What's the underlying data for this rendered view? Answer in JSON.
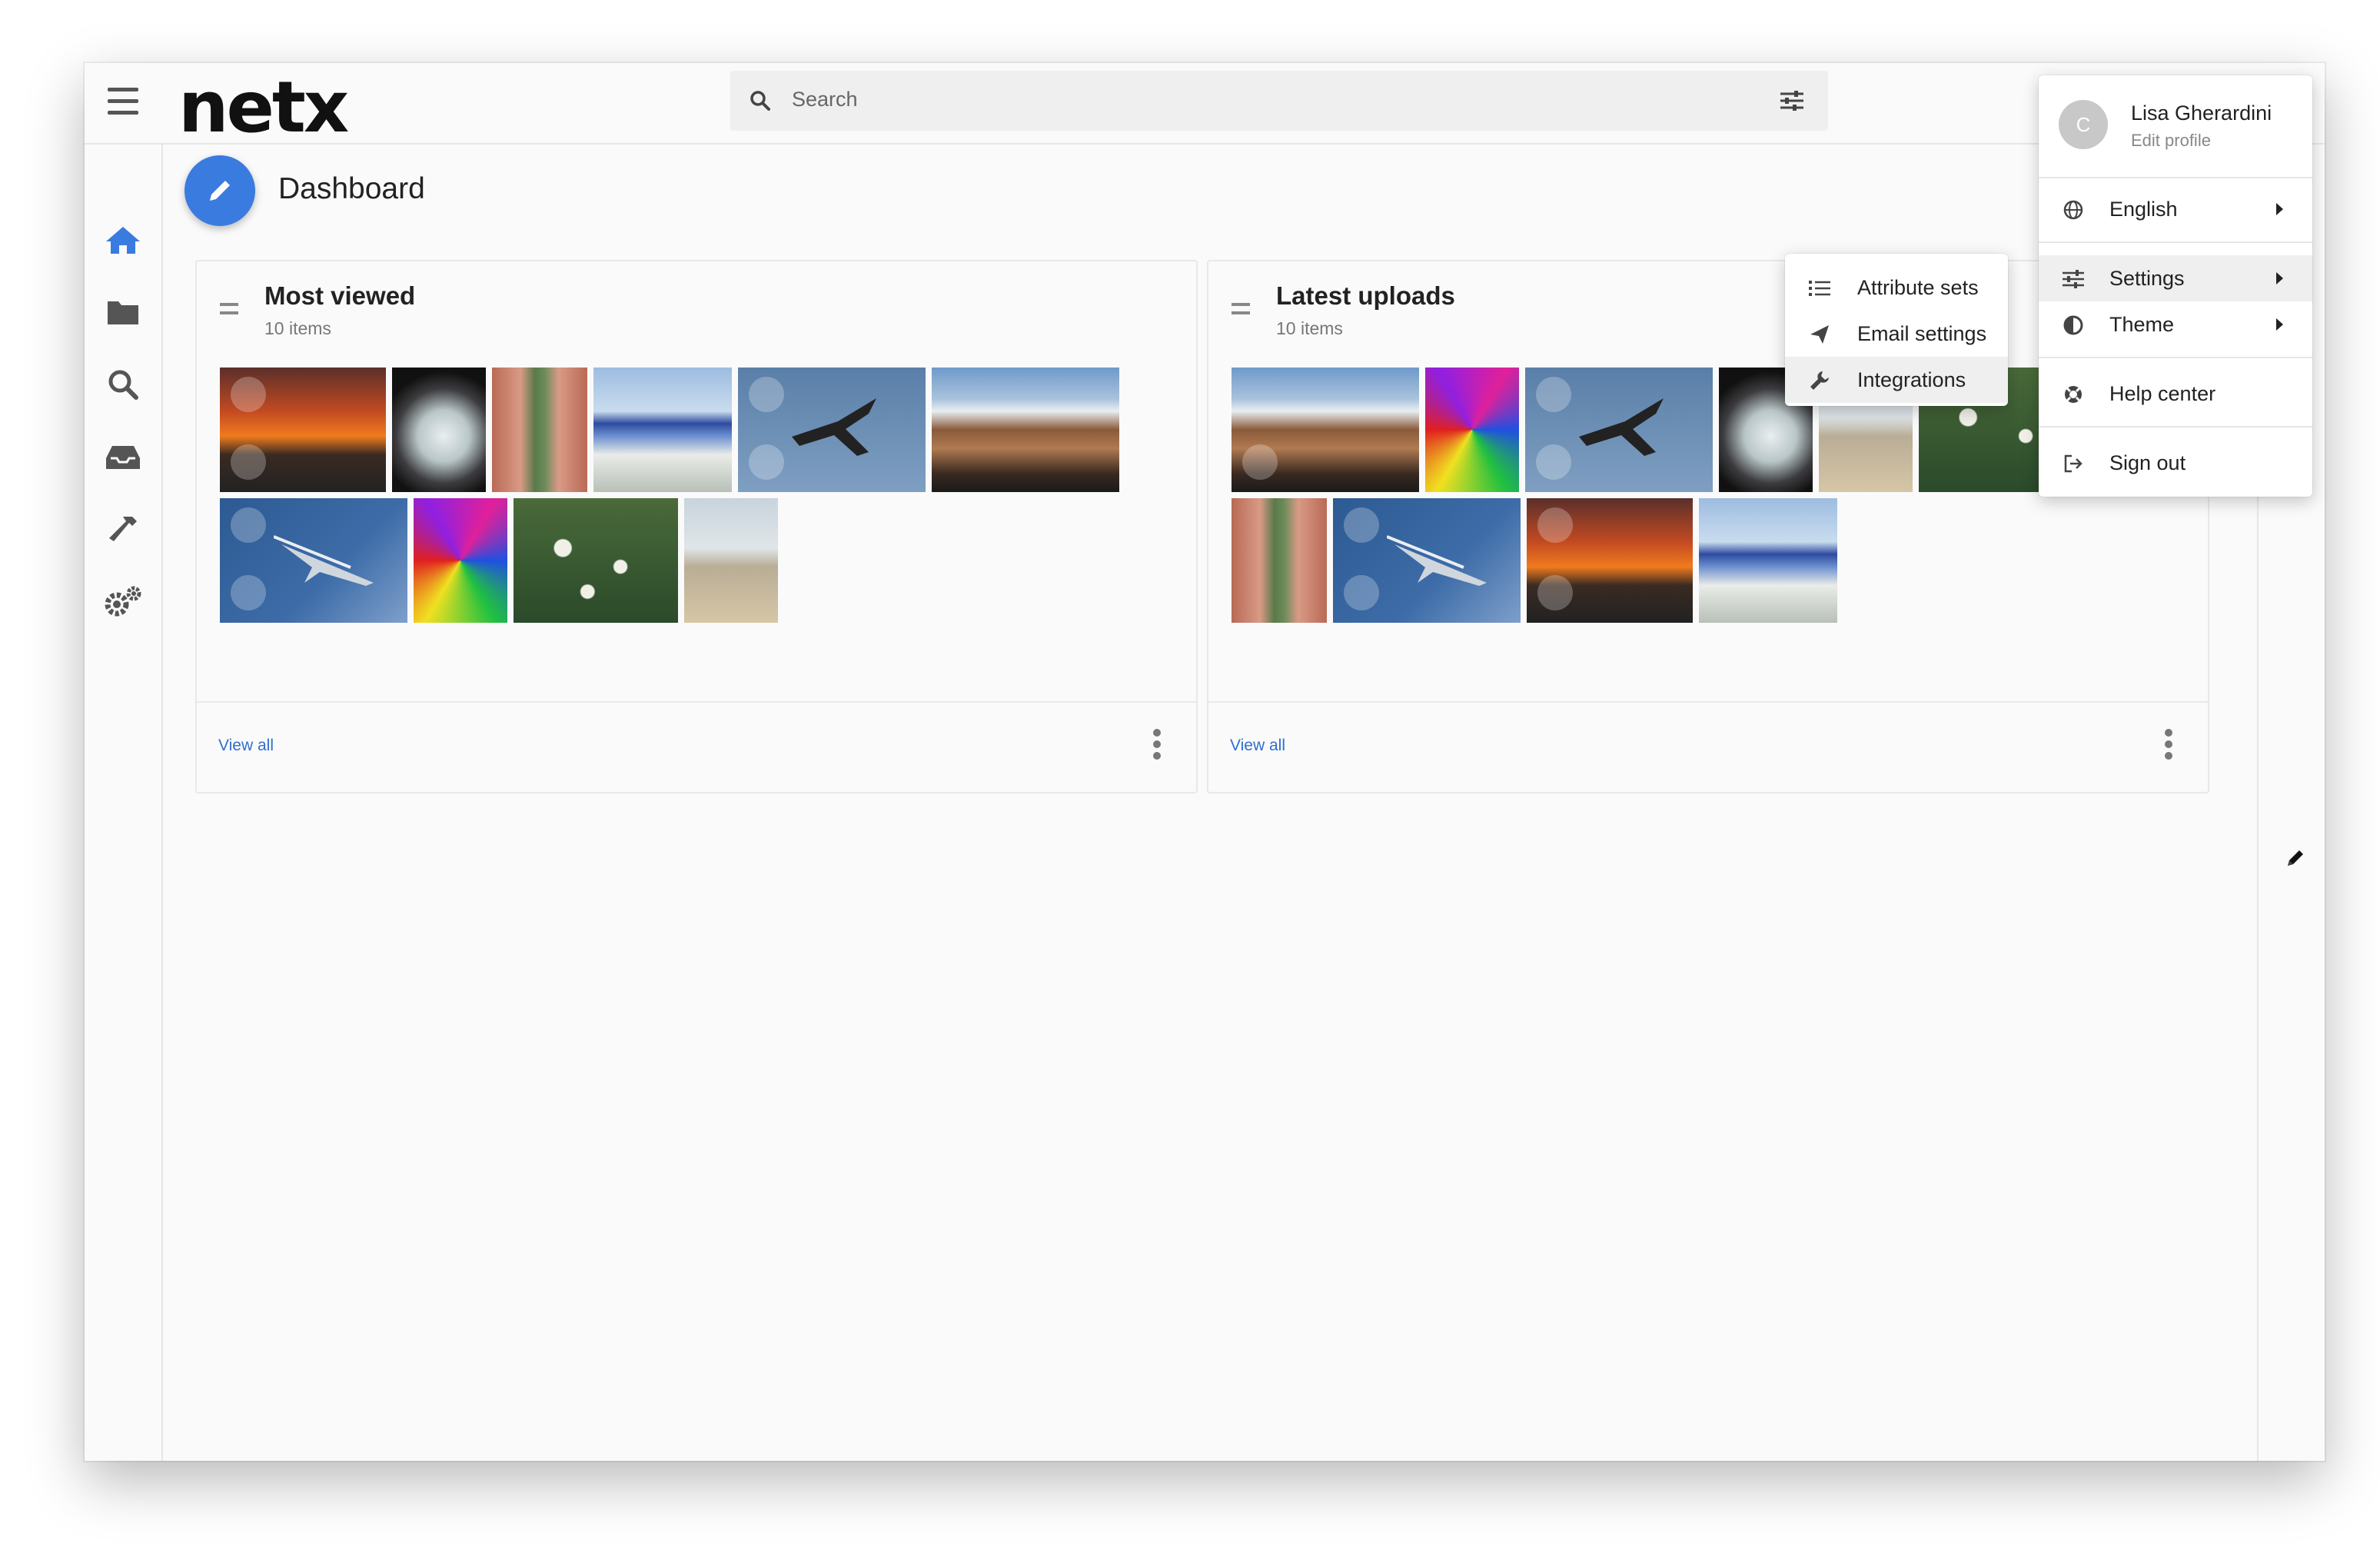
{
  "app": {
    "logo": "netx"
  },
  "search": {
    "placeholder": "Search"
  },
  "page": {
    "title": "Dashboard"
  },
  "nav": [
    "home-icon",
    "folder-icon",
    "search-icon",
    "inbox-icon",
    "hammer-icon",
    "settings-gears-icon"
  ],
  "colors": {
    "accent": "#3a7be0",
    "link": "#2f6fd0"
  },
  "cards": [
    {
      "title": "Most viewed",
      "count": "10 items",
      "view_all": "View all"
    },
    {
      "title": "Latest uploads",
      "count": "10 items",
      "view_all": "View all"
    }
  ],
  "profile_menu": {
    "avatar_initial": "C",
    "user_name": "Lisa Gherardini",
    "edit_profile": "Edit profile",
    "items": [
      {
        "label": "English",
        "icon": "globe-icon"
      },
      {
        "label": "Settings",
        "icon": "sliders-icon"
      },
      {
        "label": "Theme",
        "icon": "contrast-icon"
      },
      {
        "label": "Help center",
        "icon": "lifebuoy-icon"
      },
      {
        "label": "Sign out",
        "icon": "sign-out-icon"
      }
    ]
  },
  "settings_submenu": {
    "items": [
      {
        "label": "Attribute sets",
        "icon": "list-icon"
      },
      {
        "label": "Email settings",
        "icon": "paper-plane-icon"
      },
      {
        "label": "Integrations",
        "icon": "wrench-icon"
      }
    ]
  }
}
